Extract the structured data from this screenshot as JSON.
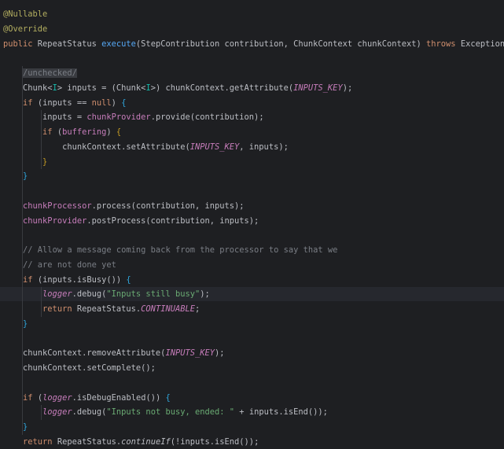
{
  "editor": {
    "language": "Java",
    "theme_colors": {
      "background": "#1e1f22",
      "text": "#bcbec4",
      "keyword": "#cf8e6d",
      "annotation": "#b3ae60",
      "method_declaration": "#56a8f5",
      "field": "#c77dbb",
      "string": "#6aab73",
      "comment": "#7a7e85",
      "type_parameter": "#16baac",
      "current_line": "#26282e"
    },
    "current_line": 19,
    "lines": [
      [
        {
          "t": "@Nullable",
          "c": "t-ann"
        }
      ],
      [
        {
          "t": "@Override",
          "c": "t-ann"
        }
      ],
      [
        {
          "t": "public ",
          "c": "t-kw"
        },
        {
          "t": "RepeatStatus "
        },
        {
          "t": "execute",
          "c": "t-fn"
        },
        {
          "t": "(StepContribution contribution, ChunkContext chunkContext) "
        },
        {
          "t": "throws ",
          "c": "t-kw"
        },
        {
          "t": "Exception "
        },
        {
          "t": "{",
          "c": "t-brace"
        }
      ],
      [],
      [
        {
          "t": "    "
        },
        {
          "t": "/unchecked/",
          "c": "t-cmt-box"
        }
      ],
      [
        {
          "t": "    Chunk<"
        },
        {
          "t": "I",
          "c": "t-gen"
        },
        {
          "t": "> inputs = (Chunk<"
        },
        {
          "t": "I",
          "c": "t-gen"
        },
        {
          "t": ">) chunkContext.getAttribute("
        },
        {
          "t": "INPUTS_KEY",
          "c": "t-const"
        },
        {
          "t": ");"
        }
      ],
      [
        {
          "t": "    "
        },
        {
          "t": "if ",
          "c": "t-kw"
        },
        {
          "t": "(inputs == "
        },
        {
          "t": "null",
          "c": "t-kw"
        },
        {
          "t": ") "
        },
        {
          "t": "{",
          "c": "t-brace2"
        }
      ],
      [
        {
          "t": "        inputs = "
        },
        {
          "t": "chunkProvider",
          "c": "t-field"
        },
        {
          "t": ".provide(contribution);"
        }
      ],
      [
        {
          "t": "        "
        },
        {
          "t": "if ",
          "c": "t-kw"
        },
        {
          "t": "("
        },
        {
          "t": "buffering",
          "c": "t-field"
        },
        {
          "t": ") "
        },
        {
          "t": "{",
          "c": "t-brace3"
        }
      ],
      [
        {
          "t": "            chunkContext.setAttribute("
        },
        {
          "t": "INPUTS_KEY",
          "c": "t-const"
        },
        {
          "t": ", inputs);"
        }
      ],
      [
        {
          "t": "        "
        },
        {
          "t": "}",
          "c": "t-brace3"
        }
      ],
      [
        {
          "t": "    "
        },
        {
          "t": "}",
          "c": "t-brace2"
        }
      ],
      [],
      [
        {
          "t": "    "
        },
        {
          "t": "chunkProcessor",
          "c": "t-field"
        },
        {
          "t": ".process(contribution, inputs);"
        }
      ],
      [
        {
          "t": "    "
        },
        {
          "t": "chunkProvider",
          "c": "t-field"
        },
        {
          "t": ".postProcess(contribution, inputs);"
        }
      ],
      [],
      [
        {
          "t": "    "
        },
        {
          "t": "// Allow a message coming back from the processor to say that we",
          "c": "t-cmt"
        }
      ],
      [
        {
          "t": "    "
        },
        {
          "t": "// are not done yet",
          "c": "t-cmt"
        }
      ],
      [
        {
          "t": "    "
        },
        {
          "t": "if ",
          "c": "t-kw"
        },
        {
          "t": "(inputs.isBusy()) "
        },
        {
          "t": "{",
          "c": "t-brace2"
        }
      ],
      [
        {
          "t": "        "
        },
        {
          "t": "logger",
          "c": "t-const"
        },
        {
          "t": ".debug("
        },
        {
          "t": "\"Inputs still busy\"",
          "c": "t-str"
        },
        {
          "t": ");"
        }
      ],
      [
        {
          "t": "        "
        },
        {
          "t": "return ",
          "c": "t-kw"
        },
        {
          "t": "RepeatStatus."
        },
        {
          "t": "CONTINUABLE",
          "c": "t-const"
        },
        {
          "t": ";"
        }
      ],
      [
        {
          "t": "    "
        },
        {
          "t": "}",
          "c": "t-brace2"
        }
      ],
      [],
      [
        {
          "t": "    chunkContext.removeAttribute("
        },
        {
          "t": "INPUTS_KEY",
          "c": "t-const"
        },
        {
          "t": ");"
        }
      ],
      [
        {
          "t": "    chunkContext.setComplete();"
        }
      ],
      [],
      [
        {
          "t": "    "
        },
        {
          "t": "if ",
          "c": "t-kw"
        },
        {
          "t": "("
        },
        {
          "t": "logger",
          "c": "t-const"
        },
        {
          "t": ".isDebugEnabled()) "
        },
        {
          "t": "{",
          "c": "t-brace2"
        }
      ],
      [
        {
          "t": "        "
        },
        {
          "t": "logger",
          "c": "t-const"
        },
        {
          "t": ".debug("
        },
        {
          "t": "\"Inputs not busy, ended: \"",
          "c": "t-str"
        },
        {
          "t": " + inputs.isEnd());"
        }
      ],
      [
        {
          "t": "    "
        },
        {
          "t": "}",
          "c": "t-brace2"
        }
      ],
      [
        {
          "t": "    "
        },
        {
          "t": "return ",
          "c": "t-kw"
        },
        {
          "t": "RepeatStatus."
        },
        {
          "t": "continueIf",
          "c": "t-static"
        },
        {
          "t": "(!inputs.isEnd());"
        }
      ]
    ]
  }
}
